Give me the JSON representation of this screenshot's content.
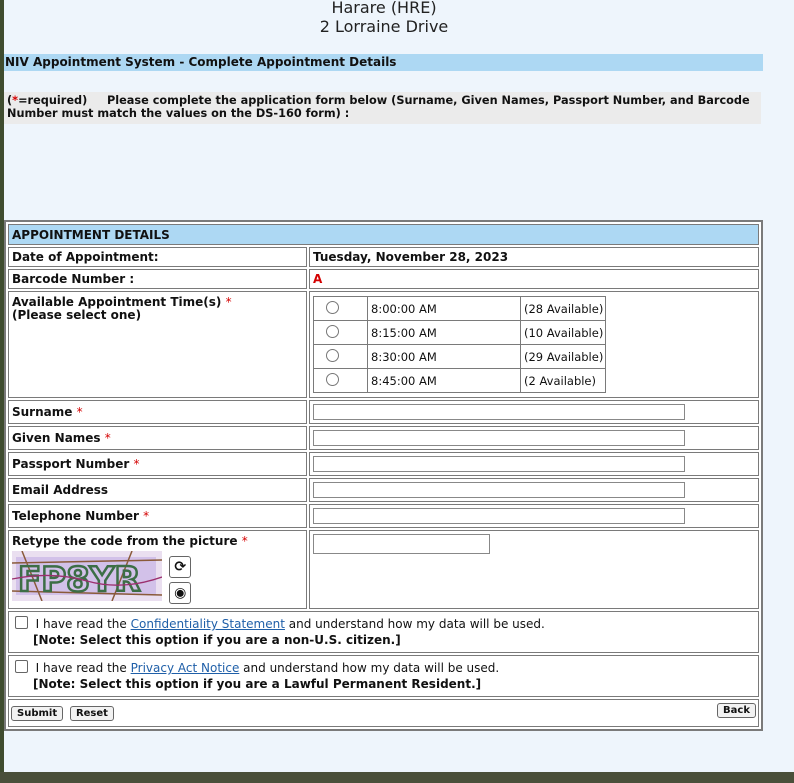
{
  "header": {
    "city": "Harare (HRE)",
    "address": "2 Lorraine Drive"
  },
  "page_title": "NIV Appointment System - Complete Appointment Details",
  "intro": {
    "required_open": "(",
    "required_star": "*",
    "required_close": "=required)",
    "text": "Please complete the application form below (Surname, Given Names, Passport Number, and Barcode Number must match the values on the DS-160 form) :"
  },
  "section_title": "APPOINTMENT DETAILS",
  "date_label": "Date of Appointment:",
  "date_value": "Tuesday, November 28, 2023",
  "barcode_label": "Barcode Number :",
  "barcode_value": "A",
  "times_label": "Available Appointment Time(s)",
  "times_sub": "(Please select one)",
  "required_star": "*",
  "slots": [
    {
      "time": "8:00:00 AM",
      "avail": "(28 Available)"
    },
    {
      "time": "8:15:00 AM",
      "avail": "(10 Available)"
    },
    {
      "time": "8:30:00 AM",
      "avail": "(29 Available)"
    },
    {
      "time": "8:45:00 AM",
      "avail": "(2 Available)"
    }
  ],
  "fields": {
    "surname": "Surname",
    "given_names": "Given Names",
    "passport": "Passport Number",
    "email": "Email Address",
    "telephone": "Telephone Number",
    "captcha": "Retype the code from the picture"
  },
  "captcha_code": "FP8YR",
  "confidentiality": {
    "prefix": "I have read the",
    "link": "Confidentiality Statement",
    "suffix": "and understand how my data will be used.",
    "note": "[Note: Select this option if you are a non-U.S. citizen.]"
  },
  "privacy": {
    "prefix": "I have read the",
    "link": "Privacy Act Notice",
    "suffix": "and understand how my data will be used.",
    "note": "[Note: Select this option if you are a Lawful Permanent Resident.]"
  },
  "buttons": {
    "submit": "Submit",
    "reset": "Reset",
    "back": "Back"
  },
  "icons": {
    "refresh": "refresh-icon",
    "audio": "audio-icon"
  },
  "colors": {
    "title_bar": "#add8f3",
    "required": "#d40000",
    "link": "#1f5fa8"
  }
}
